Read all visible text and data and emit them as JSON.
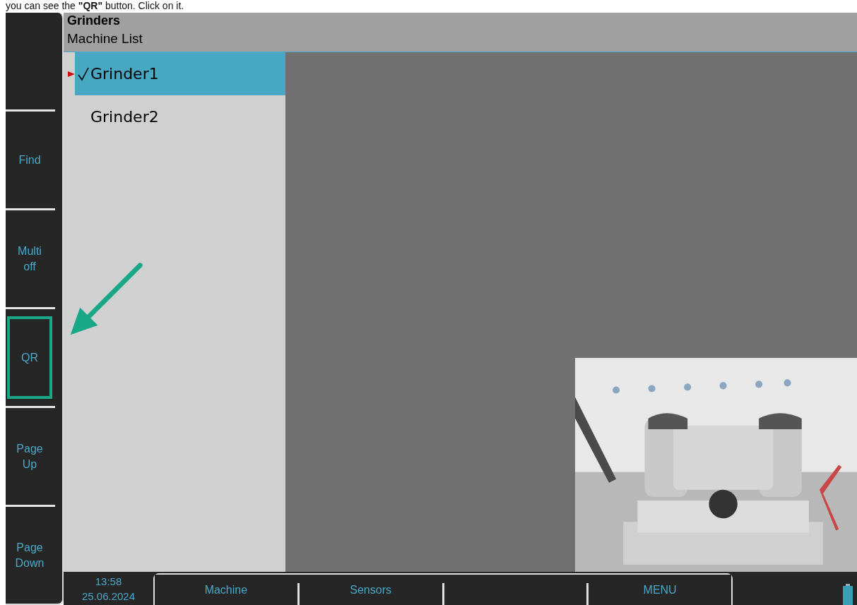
{
  "caption": "you can see the **\"QR\"** button. Click on it.",
  "header": {
    "title": "Grinders",
    "subtitle": "Machine List"
  },
  "softkeys": [
    {
      "kind": "blank"
    },
    {
      "kind": "key",
      "label": "Find",
      "highlighted": false
    },
    {
      "kind": "key",
      "label": "Multi\noff",
      "highlighted": false
    },
    {
      "kind": "key",
      "label": "QR",
      "highlighted": true
    },
    {
      "kind": "key",
      "label": "Page\nUp",
      "highlighted": false
    },
    {
      "kind": "key",
      "label": "Page\nDown",
      "highlighted": false
    }
  ],
  "machines": [
    {
      "name": "Grinder1",
      "selected": true,
      "checked": true,
      "current": true
    },
    {
      "name": "Grinder2",
      "selected": false,
      "checked": false,
      "current": false
    }
  ],
  "status_bar": {
    "time": "13:58",
    "date": "25.06.2024",
    "keys": [
      {
        "kind": "key",
        "label": "Machine"
      },
      {
        "kind": "key",
        "label": "Sensors"
      },
      {
        "kind": "blank"
      },
      {
        "kind": "key",
        "label": "MENU"
      }
    ]
  }
}
